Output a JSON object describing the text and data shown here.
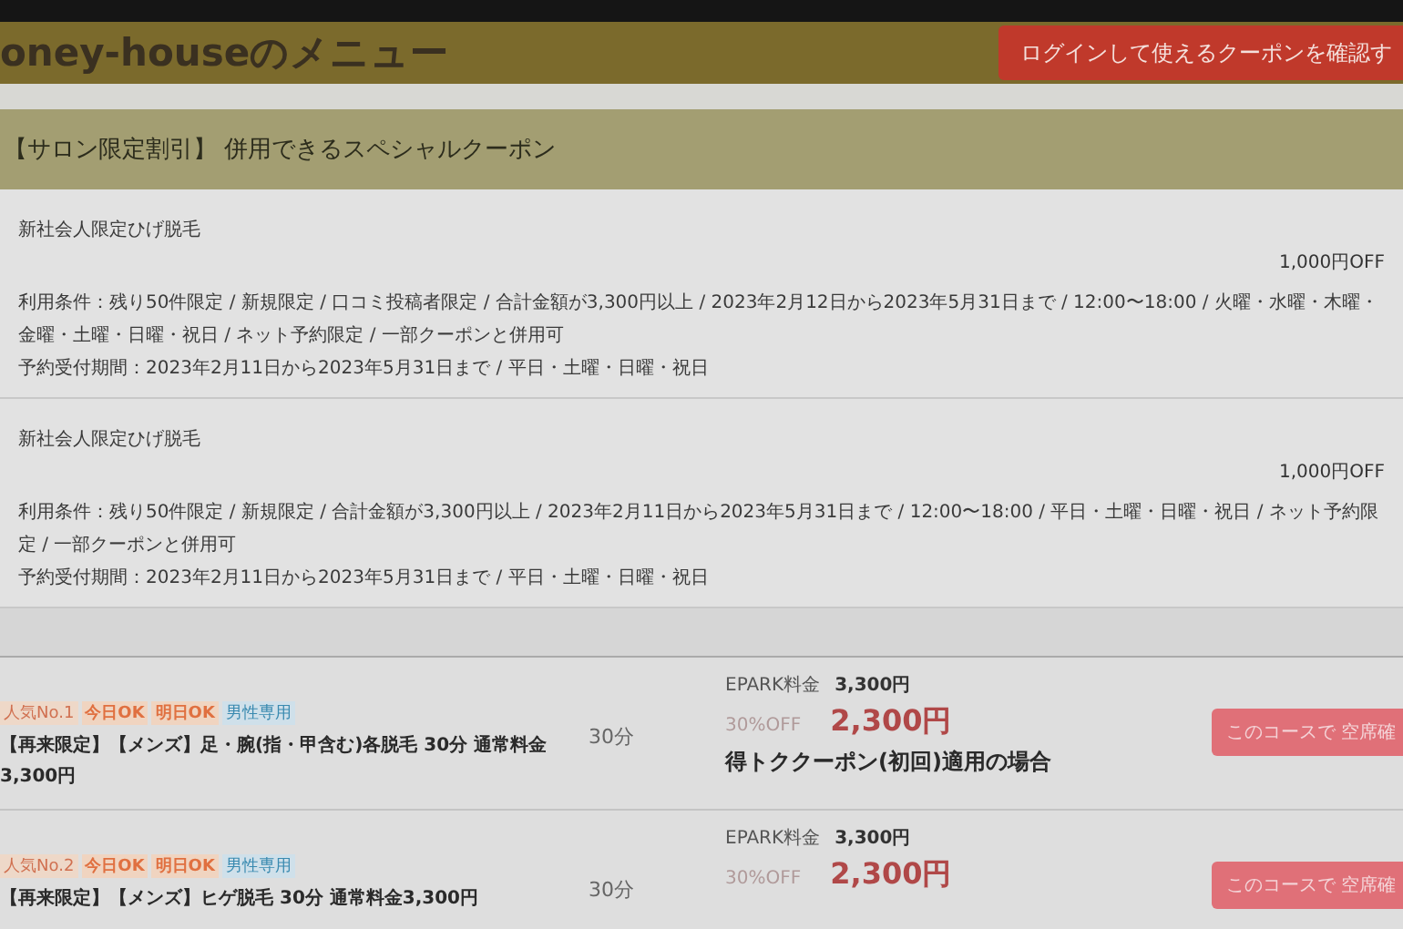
{
  "header": {
    "title": "oney-houseのメニュー",
    "login_button": "ログインして使えるクーポンを確認す"
  },
  "coupon_section": {
    "title": "【サロン限定割引】 併用できるスペシャルクーポン",
    "coupons": [
      {
        "name": "新社会人限定ひげ脱毛",
        "discount": "1,000円OFF",
        "conditions": "利用条件：残り50件限定 / 新規限定 / 口コミ投稿者限定 / 合計金額が3,300円以上 / 2023年2月12日から2023年5月31日まで / 12:00〜18:00 / 火曜・水曜・木曜・金曜・土曜・日曜・祝日 / ネット予約限定 / 一部クーポンと併用可",
        "period": "予約受付期間：2023年2月11日から2023年5月31日まで / 平日・土曜・日曜・祝日"
      },
      {
        "name": "新社会人限定ひげ脱毛",
        "discount": "1,000円OFF",
        "conditions": "利用条件：残り50件限定 / 新規限定 / 合計金額が3,300円以上 / 2023年2月11日から2023年5月31日まで / 12:00〜18:00 / 平日・土曜・日曜・祝日 / ネット予約限定 / 一部クーポンと併用可",
        "period": "予約受付期間：2023年2月11日から2023年5月31日まで / 平日・土曜・日曜・祝日"
      }
    ]
  },
  "courses": [
    {
      "tags": [
        {
          "label": "人気No.1",
          "kind": "rank"
        },
        {
          "label": "今日OK",
          "kind": "avail"
        },
        {
          "label": "明日OK",
          "kind": "avail"
        },
        {
          "label": "男性専用",
          "kind": "gender"
        }
      ],
      "title": "【再来限定】【メンズ】足・腕(指・甲含む)各脱毛 30分 通常料金3,300円",
      "duration": "30分",
      "price_label": "EPARK料金",
      "price": "3,300円",
      "discount_rate": "30%OFF",
      "discount_price": "2,300円",
      "note": "得トククーポン(初回)適用の場合",
      "button": "このコースで 空席確"
    },
    {
      "tags": [
        {
          "label": "人気No.2",
          "kind": "rank"
        },
        {
          "label": "今日OK",
          "kind": "avail"
        },
        {
          "label": "明日OK",
          "kind": "avail"
        },
        {
          "label": "男性専用",
          "kind": "gender"
        }
      ],
      "title": "【再来限定】【メンズ】ヒゲ脱毛 30分 通常料金3,300円",
      "duration": "30分",
      "price_label": "EPARK料金",
      "price": "3,300円",
      "discount_rate": "30%OFF",
      "discount_price": "2,300円",
      "button": "このコースで 空席確"
    }
  ]
}
